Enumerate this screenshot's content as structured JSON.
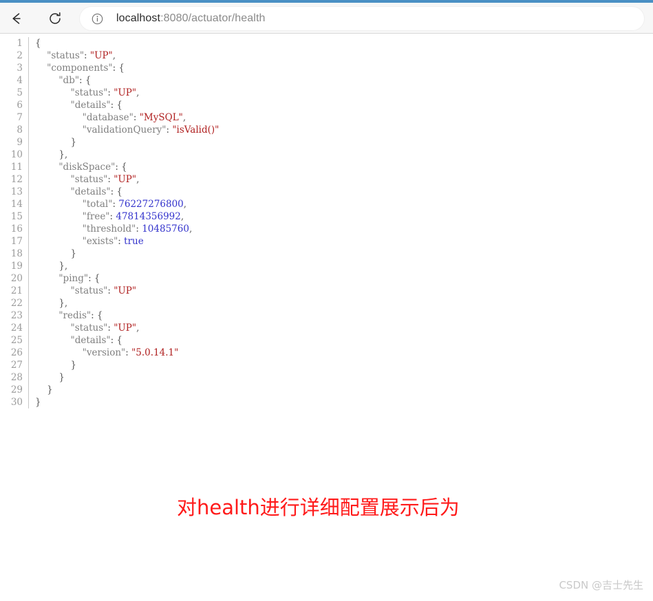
{
  "browser": {
    "back_label": "Back",
    "reload_label": "Reload",
    "site_info_label": "View site information",
    "url_host": "localhost",
    "url_path": ":8080/actuator/health",
    "url_full": "localhost:8080/actuator/health",
    "accent_color": "#4a90c4"
  },
  "viewer": {
    "colors": {
      "key": "#808080",
      "string": "#b02020",
      "number": "#3333cc",
      "boolean": "#3333cc",
      "punctuation": "#5b5b5b",
      "line_number": "#9b9b9b"
    },
    "line_numbers": [
      1,
      2,
      3,
      4,
      5,
      6,
      7,
      8,
      9,
      10,
      11,
      12,
      13,
      14,
      15,
      16,
      17,
      18,
      19,
      20,
      21,
      22,
      23,
      24,
      25,
      26,
      27,
      28,
      29,
      30
    ],
    "lines": [
      {
        "n": 1,
        "indent": 0,
        "tokens": [
          {
            "t": "punct",
            "v": "{"
          }
        ]
      },
      {
        "n": 2,
        "indent": 4,
        "tokens": [
          {
            "t": "key",
            "v": "\"status\""
          },
          {
            "t": "punct",
            "v": ": "
          },
          {
            "t": "str",
            "v": "\"UP\""
          },
          {
            "t": "punct",
            "v": ","
          }
        ]
      },
      {
        "n": 3,
        "indent": 4,
        "tokens": [
          {
            "t": "key",
            "v": "\"components\""
          },
          {
            "t": "punct",
            "v": ": {"
          }
        ]
      },
      {
        "n": 4,
        "indent": 8,
        "tokens": [
          {
            "t": "key",
            "v": "\"db\""
          },
          {
            "t": "punct",
            "v": ": {"
          }
        ]
      },
      {
        "n": 5,
        "indent": 12,
        "tokens": [
          {
            "t": "key",
            "v": "\"status\""
          },
          {
            "t": "punct",
            "v": ": "
          },
          {
            "t": "str",
            "v": "\"UP\""
          },
          {
            "t": "punct",
            "v": ","
          }
        ]
      },
      {
        "n": 6,
        "indent": 12,
        "tokens": [
          {
            "t": "key",
            "v": "\"details\""
          },
          {
            "t": "punct",
            "v": ": {"
          }
        ]
      },
      {
        "n": 7,
        "indent": 16,
        "tokens": [
          {
            "t": "key",
            "v": "\"database\""
          },
          {
            "t": "punct",
            "v": ": "
          },
          {
            "t": "str",
            "v": "\"MySQL\""
          },
          {
            "t": "punct",
            "v": ","
          }
        ]
      },
      {
        "n": 8,
        "indent": 16,
        "tokens": [
          {
            "t": "key",
            "v": "\"validationQuery\""
          },
          {
            "t": "punct",
            "v": ": "
          },
          {
            "t": "str",
            "v": "\"isValid()\""
          }
        ]
      },
      {
        "n": 9,
        "indent": 12,
        "tokens": [
          {
            "t": "punct",
            "v": "}"
          }
        ]
      },
      {
        "n": 10,
        "indent": 8,
        "tokens": [
          {
            "t": "punct",
            "v": "},"
          }
        ]
      },
      {
        "n": 11,
        "indent": 8,
        "tokens": [
          {
            "t": "key",
            "v": "\"diskSpace\""
          },
          {
            "t": "punct",
            "v": ": {"
          }
        ]
      },
      {
        "n": 12,
        "indent": 12,
        "tokens": [
          {
            "t": "key",
            "v": "\"status\""
          },
          {
            "t": "punct",
            "v": ": "
          },
          {
            "t": "str",
            "v": "\"UP\""
          },
          {
            "t": "punct",
            "v": ","
          }
        ]
      },
      {
        "n": 13,
        "indent": 12,
        "tokens": [
          {
            "t": "key",
            "v": "\"details\""
          },
          {
            "t": "punct",
            "v": ": {"
          }
        ]
      },
      {
        "n": 14,
        "indent": 16,
        "tokens": [
          {
            "t": "key",
            "v": "\"total\""
          },
          {
            "t": "punct",
            "v": ": "
          },
          {
            "t": "num",
            "v": "76227276800"
          },
          {
            "t": "punct",
            "v": ","
          }
        ]
      },
      {
        "n": 15,
        "indent": 16,
        "tokens": [
          {
            "t": "key",
            "v": "\"free\""
          },
          {
            "t": "punct",
            "v": ": "
          },
          {
            "t": "num",
            "v": "47814356992"
          },
          {
            "t": "punct",
            "v": ","
          }
        ]
      },
      {
        "n": 16,
        "indent": 16,
        "tokens": [
          {
            "t": "key",
            "v": "\"threshold\""
          },
          {
            "t": "punct",
            "v": ": "
          },
          {
            "t": "num",
            "v": "10485760"
          },
          {
            "t": "punct",
            "v": ","
          }
        ]
      },
      {
        "n": 17,
        "indent": 16,
        "tokens": [
          {
            "t": "key",
            "v": "\"exists\""
          },
          {
            "t": "punct",
            "v": ": "
          },
          {
            "t": "bool",
            "v": "true"
          }
        ]
      },
      {
        "n": 18,
        "indent": 12,
        "tokens": [
          {
            "t": "punct",
            "v": "}"
          }
        ]
      },
      {
        "n": 19,
        "indent": 8,
        "tokens": [
          {
            "t": "punct",
            "v": "},"
          }
        ]
      },
      {
        "n": 20,
        "indent": 8,
        "tokens": [
          {
            "t": "key",
            "v": "\"ping\""
          },
          {
            "t": "punct",
            "v": ": {"
          }
        ]
      },
      {
        "n": 21,
        "indent": 12,
        "tokens": [
          {
            "t": "key",
            "v": "\"status\""
          },
          {
            "t": "punct",
            "v": ": "
          },
          {
            "t": "str",
            "v": "\"UP\""
          }
        ]
      },
      {
        "n": 22,
        "indent": 8,
        "tokens": [
          {
            "t": "punct",
            "v": "},"
          }
        ]
      },
      {
        "n": 23,
        "indent": 8,
        "tokens": [
          {
            "t": "key",
            "v": "\"redis\""
          },
          {
            "t": "punct",
            "v": ": {"
          }
        ]
      },
      {
        "n": 24,
        "indent": 12,
        "tokens": [
          {
            "t": "key",
            "v": "\"status\""
          },
          {
            "t": "punct",
            "v": ": "
          },
          {
            "t": "str",
            "v": "\"UP\""
          },
          {
            "t": "punct",
            "v": ","
          }
        ]
      },
      {
        "n": 25,
        "indent": 12,
        "tokens": [
          {
            "t": "key",
            "v": "\"details\""
          },
          {
            "t": "punct",
            "v": ": {"
          }
        ]
      },
      {
        "n": 26,
        "indent": 16,
        "tokens": [
          {
            "t": "key",
            "v": "\"version\""
          },
          {
            "t": "punct",
            "v": ": "
          },
          {
            "t": "str",
            "v": "\"5.0.14.1\""
          }
        ]
      },
      {
        "n": 27,
        "indent": 12,
        "tokens": [
          {
            "t": "punct",
            "v": "}"
          }
        ]
      },
      {
        "n": 28,
        "indent": 8,
        "tokens": [
          {
            "t": "punct",
            "v": "}"
          }
        ]
      },
      {
        "n": 29,
        "indent": 4,
        "tokens": [
          {
            "t": "punct",
            "v": "}"
          }
        ]
      },
      {
        "n": 30,
        "indent": 0,
        "tokens": [
          {
            "t": "punct",
            "v": "}"
          }
        ]
      }
    ]
  },
  "annotation": {
    "text": "对health进行详细配置展示后为",
    "color": "#ff1a1a"
  },
  "watermark": {
    "text": "CSDN @吉士先生"
  }
}
